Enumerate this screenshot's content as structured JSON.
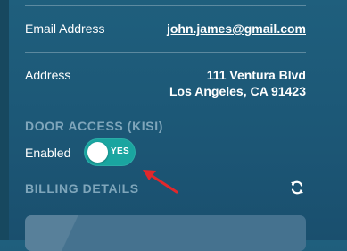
{
  "contact": {
    "email_label": "Email Address",
    "email_value": "john.james@gmail.com",
    "address_label": "Address",
    "address_line1": "111 Ventura Blvd",
    "address_line2": "Los Angeles, CA 91423"
  },
  "door_access": {
    "section_title": "DOOR ACCESS (KISI)",
    "enabled_label": "Enabled",
    "toggle_text": "YES",
    "toggle_on": true
  },
  "billing": {
    "section_title": "BILLING DETAILS",
    "refresh_icon": "refresh-icon"
  },
  "colors": {
    "background": "#1c5776",
    "toggle_on": "#1aa5a0",
    "section_heading": "#7fa6bb",
    "annotation_arrow": "#e0282c"
  }
}
